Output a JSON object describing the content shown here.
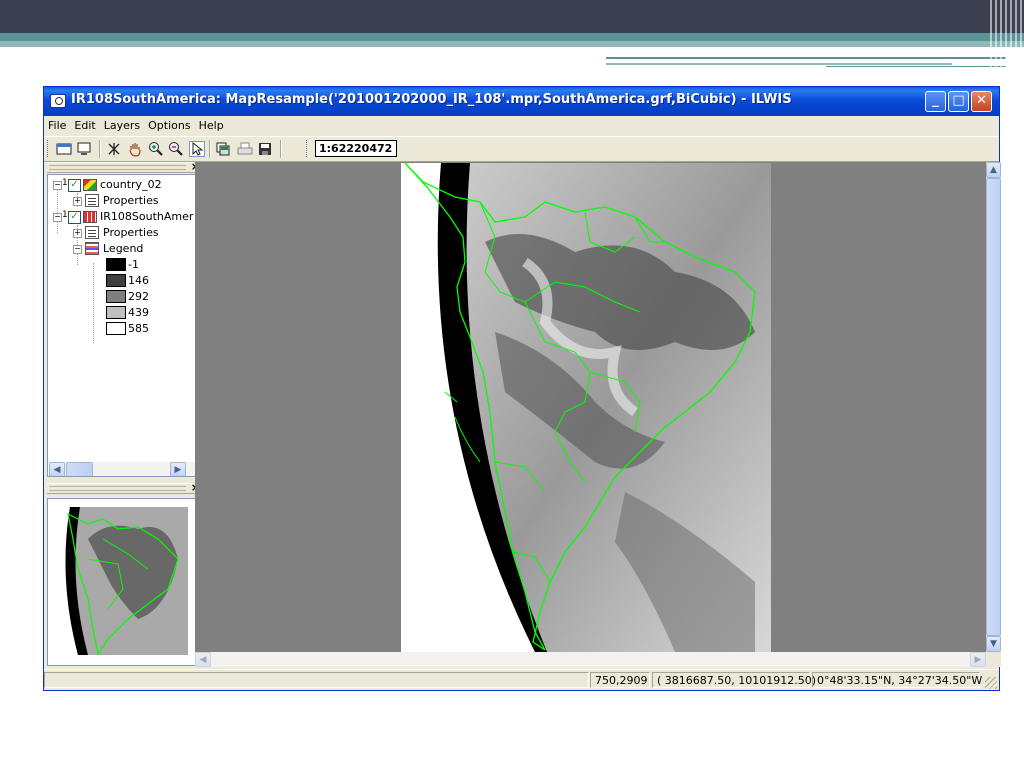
{
  "window": {
    "title": "IR108SouthAmerica: MapResample('201001202000_IR_108'.mpr,SouthAmerica.grf,BiCubic) - ILWIS",
    "controls": {
      "minimize": "_",
      "maximize": "□",
      "close": "✕"
    }
  },
  "menu": [
    "File",
    "Edit",
    "Layers",
    "Options",
    "Help"
  ],
  "toolbar": {
    "icons": [
      "entire-map-icon",
      "normal-view-icon",
      "measure-distance-icon",
      "pan-icon",
      "zoom-in-icon",
      "zoom-out-icon",
      "select-pointer-icon",
      "copy-icon",
      "print-icon",
      "save-icon"
    ],
    "scale": "1:62220472"
  },
  "layers": [
    {
      "name": "country_02",
      "checked": true,
      "children": [
        "Properties"
      ]
    },
    {
      "name": "IR108SouthAmer",
      "checked": true,
      "children": [
        "Properties",
        "Legend"
      ]
    }
  ],
  "legend": [
    {
      "label": "-1",
      "color": "#000000"
    },
    {
      "label": "146",
      "color": "#3f3f3f"
    },
    {
      "label": "292",
      "color": "#7f7f7f"
    },
    {
      "label": "439",
      "color": "#bfbfbf"
    },
    {
      "label": "585",
      "color": "#ffffff"
    }
  ],
  "colors": {
    "map_background": "#808080",
    "country_boundary": "#00ff00",
    "title_bar": "#0b4ad9"
  },
  "status": {
    "pixel": "750,2909",
    "coords": "( 3816687.50, 10101912.50)",
    "latlon": "0°48'33.15\"N, 34°27'34.50\"W"
  }
}
